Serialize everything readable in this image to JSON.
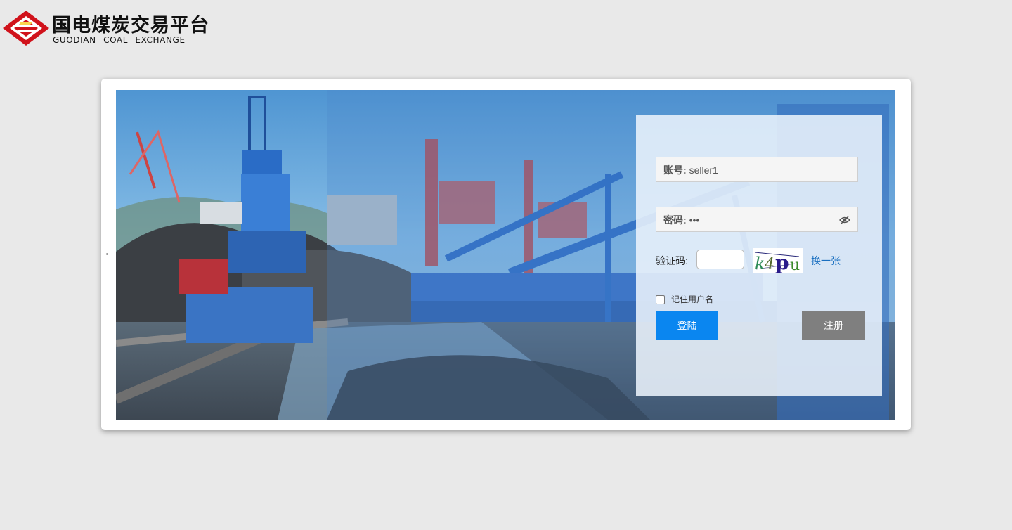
{
  "brand": {
    "name_cn": "国电煤炭交易平台",
    "name_en": "GUODIAN COAL EXCHANGE"
  },
  "login": {
    "account_label": "账号:",
    "account_value": "seller1",
    "password_label": "密码:",
    "password_value": "•••",
    "captcha_label": "验证码:",
    "captcha_value": "",
    "captcha_text": "k4pu",
    "captcha_refresh": "换一张",
    "remember_label": "记住用户名",
    "remember_checked": false,
    "login_button": "登陆",
    "register_button": "注册"
  },
  "icons": {
    "logo": "guodian-diamond-logo",
    "password_toggle": "eye-slash-icon"
  },
  "colors": {
    "page_bg": "#e9e9e9",
    "primary": "#0a86f0",
    "secondary": "#7f7f7f",
    "logo_red": "#d0121b",
    "link": "#1a6fc0"
  }
}
